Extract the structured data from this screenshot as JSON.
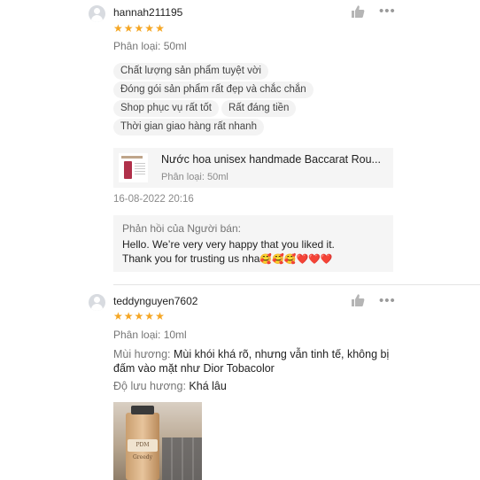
{
  "reviews": [
    {
      "username": "hannah211195",
      "rating": 5,
      "variant": "Phân loại: 50ml",
      "tags": [
        "Chất lượng sản phẩm tuyệt vời",
        "Đóng gói sản phẩm rất đẹp và chắc chắn",
        "Shop phục vụ rất tốt",
        "Rất đáng tiền",
        "Thời gian giao hàng rất nhanh"
      ],
      "product": {
        "name": "Nước hoa unisex handmade Baccarat Rou...",
        "variant": "Phân loại: 50ml"
      },
      "timestamp": "16-08-2022 20:16",
      "seller_reply": {
        "title": "Phản hồi của Người bán:",
        "line1": "Hello. We’re very very happy that you liked it.",
        "line2": "Thank you for trusting us nha",
        "emojis": "🥰🥰🥰❤️❤️❤️"
      }
    },
    {
      "username": "teddynguyen7602",
      "rating": 5,
      "variant": "Phân loại: 10ml",
      "scent_key": "Mùi hương:",
      "scent_value_1": "Mùi khói khá rõ, nhưng vẫn tinh tế, không bị",
      "scent_value_2": "đấm vào mặt như Dior Tobacolor",
      "longevity_key": "Độ lưu hương:",
      "longevity_value": "Khá lâu",
      "media_label": "PDM Greedy"
    }
  ],
  "icons": {
    "like": "thumbs-up-icon",
    "more": "more-dots-icon",
    "star": "star-icon",
    "avatar": "user-avatar-icon"
  },
  "colors": {
    "star": "#f5a623",
    "muted_text": "#757575",
    "tag_bg": "#f3f3f3",
    "card_bg": "#f5f5f5"
  }
}
